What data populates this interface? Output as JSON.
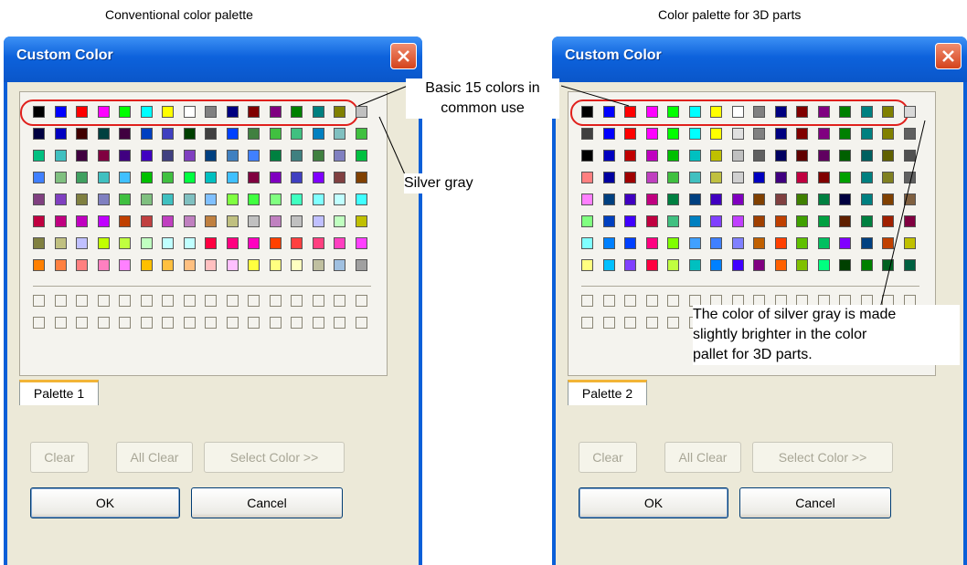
{
  "captions": {
    "left": "Conventional color palette",
    "right": "Color palette for 3D parts"
  },
  "dialogs": [
    {
      "title": "Custom Color",
      "tab_label": "Palette 1",
      "buttons": {
        "clear": "Clear",
        "all_clear": "All Clear",
        "select_color": "Select Color >>",
        "ok": "OK",
        "cancel": "Cancel"
      }
    },
    {
      "title": "Custom Color",
      "tab_label": "Palette 2",
      "buttons": {
        "clear": "Clear",
        "all_clear": "All Clear",
        "select_color": "Select Color >>",
        "ok": "OK",
        "cancel": "Cancel"
      }
    }
  ],
  "annotations": {
    "basic_colors": [
      "Basic 15 colors in",
      "common use"
    ],
    "silver_gray": "Silver gray",
    "silver_note": [
      "The color of silver gray is made",
      "slightly brighter in the color",
      "pallet for 3D parts."
    ]
  },
  "palette1": [
    [
      "#000000",
      "#0000ff",
      "#ff0000",
      "#ff00ff",
      "#00ff00",
      "#00ffff",
      "#ffff00",
      "#ffffff",
      "#808080",
      "#000080",
      "#800000",
      "#800080",
      "#008000",
      "#008080",
      "#808000",
      "#c0c0c0"
    ],
    [
      "#000040",
      "#0000c0",
      "#400000",
      "#004040",
      "#400040",
      "#0040c0",
      "#4040c0",
      "#004000",
      "#404040",
      "#0040ff",
      "#408040",
      "#40c040",
      "#40c080",
      "#0080c0",
      "#80c0c0",
      "#40c040"
    ],
    [
      "#00c080",
      "#40c0c0",
      "#400040",
      "#800040",
      "#400080",
      "#4000c0",
      "#404080",
      "#8040c0",
      "#004080",
      "#4080c0",
      "#4080ff",
      "#008040",
      "#408080",
      "#408040",
      "#8080c0",
      "#00c040"
    ],
    [
      "#4080ff",
      "#80c080",
      "#40a060",
      "#40c0c0",
      "#40c0ff",
      "#00c000",
      "#40c040",
      "#00ff40",
      "#00c0c0",
      "#40c0ff",
      "#800040",
      "#8000c0",
      "#4040c0",
      "#8000ff",
      "#804040",
      "#804000"
    ],
    [
      "#804080",
      "#8040c0",
      "#808040",
      "#8080c0",
      "#40c040",
      "#80c080",
      "#40c0c0",
      "#80c0c0",
      "#80c0ff",
      "#80ff40",
      "#40ff40",
      "#80ff80",
      "#40ffc0",
      "#80ffff",
      "#c0ffff",
      "#40ffff"
    ],
    [
      "#c00040",
      "#c00080",
      "#c000c0",
      "#c000ff",
      "#c04000",
      "#c04040",
      "#c040c0",
      "#c080c0",
      "#c08040",
      "#c0c080",
      "#c0c0c0",
      "#c080c0",
      "#c0c0c0",
      "#c0c0ff",
      "#c0ffc0",
      "#c0c000"
    ],
    [
      "#808040",
      "#c0c080",
      "#c0c0ff",
      "#c0ff00",
      "#c0ff40",
      "#c0ffc0",
      "#c0ffff",
      "#c0ffff",
      "#ff0040",
      "#ff0080",
      "#ff00c0",
      "#ff4000",
      "#ff4040",
      "#ff4080",
      "#ff40c0",
      "#ff40ff"
    ],
    [
      "#ff8000",
      "#ff8040",
      "#ff8080",
      "#ff80c0",
      "#ff80ff",
      "#ffc000",
      "#ffc040",
      "#ffc080",
      "#ffc0c0",
      "#ffc0ff",
      "#ffff40",
      "#ffff80",
      "#ffffc0",
      "#c0c0a0",
      "#a0c0e0",
      "#a0a0a0"
    ]
  ],
  "palette2": [
    [
      "#000000",
      "#0000ff",
      "#ff0000",
      "#ff00ff",
      "#00ff00",
      "#00ffff",
      "#ffff00",
      "#ffffff",
      "#808080",
      "#000080",
      "#800000",
      "#800080",
      "#008000",
      "#008080",
      "#808000",
      "#d8d8d8"
    ],
    [
      "#404040",
      "#0000ff",
      "#ff0000",
      "#ff00ff",
      "#00ff00",
      "#00ffff",
      "#ffff00",
      "#e0e0e0",
      "#808080",
      "#000080",
      "#800000",
      "#800080",
      "#008000",
      "#008080",
      "#808000",
      "#606060"
    ],
    [
      "#000000",
      "#0000c0",
      "#c00000",
      "#c000c0",
      "#00c000",
      "#00c0c0",
      "#c0c000",
      "#c0c0c0",
      "#606060",
      "#000060",
      "#600000",
      "#600060",
      "#006000",
      "#006060",
      "#606000",
      "#505050"
    ],
    [
      "#ff8080",
      "#0000a0",
      "#a00000",
      "#c040c0",
      "#40c040",
      "#40c0c0",
      "#c0c040",
      "#d0d0d0",
      "#0000c0",
      "#400080",
      "#c00040",
      "#800000",
      "#00a000",
      "#008080",
      "#808020",
      "#606060"
    ],
    [
      "#ff80ff",
      "#004080",
      "#4000c0",
      "#c00080",
      "#008040",
      "#004080",
      "#4000c0",
      "#8000c0",
      "#804000",
      "#804040",
      "#408000",
      "#008040",
      "#000040",
      "#008080",
      "#804000",
      "#806040"
    ],
    [
      "#80ff80",
      "#0040c0",
      "#4000ff",
      "#c00040",
      "#40c080",
      "#0080c0",
      "#8040ff",
      "#c040ff",
      "#a04000",
      "#c04000",
      "#40a000",
      "#00a040",
      "#602000",
      "#008040",
      "#a02000",
      "#800040"
    ],
    [
      "#80ffff",
      "#0080ff",
      "#0040ff",
      "#ff0080",
      "#80ff00",
      "#40a0ff",
      "#4080ff",
      "#8080ff",
      "#c06000",
      "#ff4000",
      "#60c000",
      "#00c060",
      "#8000ff",
      "#004080",
      "#c04000",
      "#c0c000"
    ],
    [
      "#ffff80",
      "#00c0ff",
      "#8040ff",
      "#ff0040",
      "#c0ff40",
      "#00c0c0",
      "#0080ff",
      "#4000ff",
      "#800080",
      "#ff6000",
      "#80c000",
      "#00ff80",
      "#004000",
      "#008000",
      "#006020",
      "#006040"
    ]
  ]
}
